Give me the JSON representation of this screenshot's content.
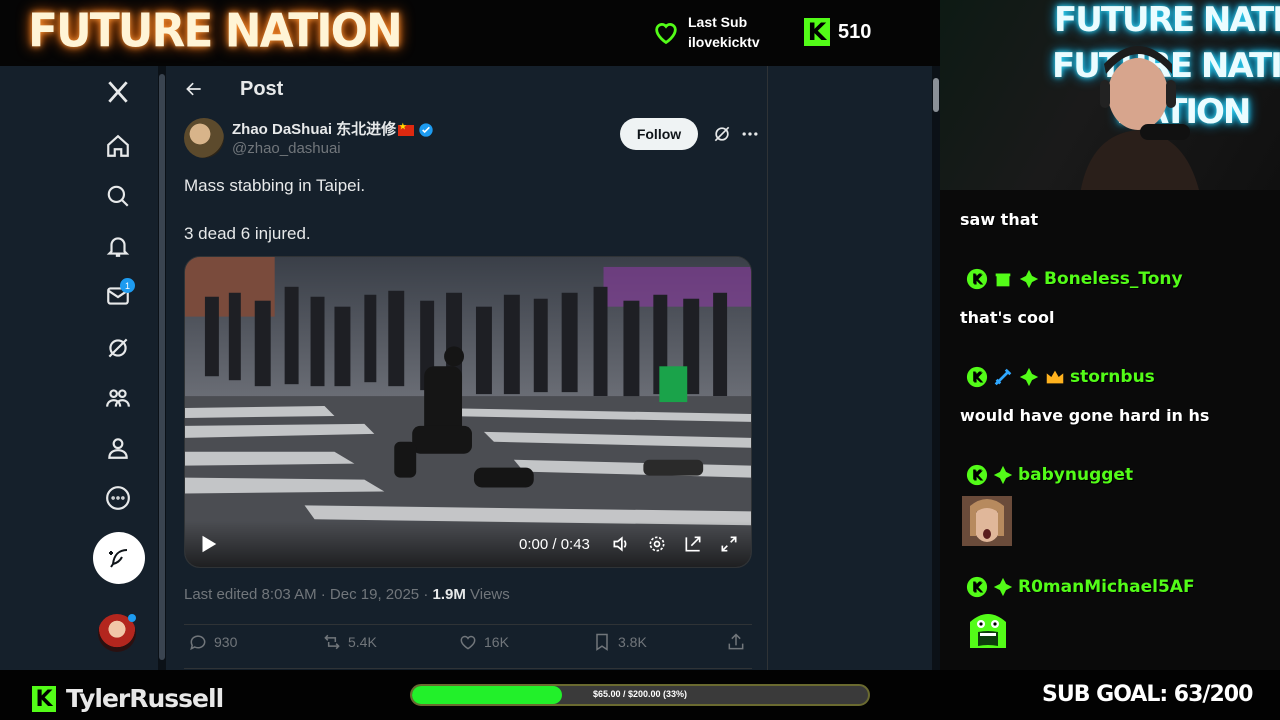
{
  "overlay": {
    "brand": "FUTURE NATION",
    "last_sub_label": "Last Sub",
    "last_sub_user": "ilovekicktv",
    "kick_logo": "K",
    "follower_count": "510",
    "streamer_name": "TylerRussell",
    "goal_text": "$65.00 / $200.00 (33%)",
    "goal_progress": 0.33,
    "sub_goal": "SUB GOAL: 63/200",
    "accent_color": "#53fc18"
  },
  "webcam": {
    "neon_lines": [
      "FUTURE NATION",
      "FUTURE NATION",
      "NATION"
    ]
  },
  "nav": {
    "items": [
      {
        "name": "x-logo-icon"
      },
      {
        "name": "home-icon"
      },
      {
        "name": "search-icon"
      },
      {
        "name": "notifications-icon"
      },
      {
        "name": "messages-icon",
        "badge": "1"
      },
      {
        "name": "grok-icon"
      },
      {
        "name": "communities-icon"
      },
      {
        "name": "profile-icon"
      },
      {
        "name": "more-icon"
      }
    ]
  },
  "post": {
    "header_title": "Post",
    "author_name": "Zhao DaShuai 东北进修",
    "author_handle": "@zhao_dashuai",
    "follow_label": "Follow",
    "text_lines": [
      "Mass stabbing in Taipei.",
      "3 dead 6 injured."
    ],
    "video_time": "0:00 / 0:43",
    "meta_edited": "Last edited 8:03 AM · Dec 19, 2025 · ",
    "meta_views": "1.9M",
    "meta_views_label": " Views",
    "replies": "930",
    "reposts": "5.4K",
    "likes": "16K",
    "bookmarks": "3.8K"
  },
  "chat": {
    "messages": [
      {
        "text": "saw that"
      },
      {
        "user": "Boneless_Tony",
        "text": "that's cool"
      },
      {
        "user": "stornbus",
        "text": "would have gone hard in hs"
      },
      {
        "user": "babynugget"
      },
      {
        "user": "R0manMichael5AF"
      }
    ]
  }
}
